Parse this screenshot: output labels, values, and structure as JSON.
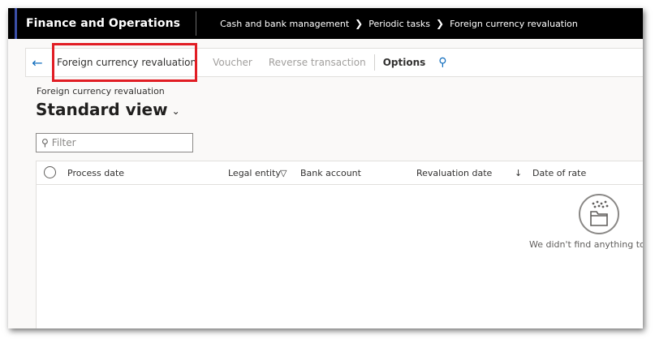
{
  "nav": {
    "app_title": "Finance and Operations",
    "breadcrumb": [
      "Cash and bank management",
      "Periodic tasks",
      "Foreign currency revaluation"
    ]
  },
  "actionpane": {
    "items": [
      {
        "label": "Foreign currency revaluation",
        "state": "enabled"
      },
      {
        "label": "Voucher",
        "state": "disabled"
      },
      {
        "label": "Reverse transaction",
        "state": "disabled"
      },
      {
        "label": "Options",
        "state": "bold"
      }
    ]
  },
  "page": {
    "caption": "Foreign currency revaluation",
    "view_name": "Standard view"
  },
  "filter": {
    "placeholder": "Filter"
  },
  "grid": {
    "columns": [
      "Process date",
      "Legal entity",
      "Bank account",
      "Revaluation date",
      "Date of rate"
    ],
    "empty_message": "We didn't find anything to sh"
  },
  "colors": {
    "highlight": "#e11d24",
    "accent": "#0f6cbd",
    "navbar": "#000000"
  }
}
